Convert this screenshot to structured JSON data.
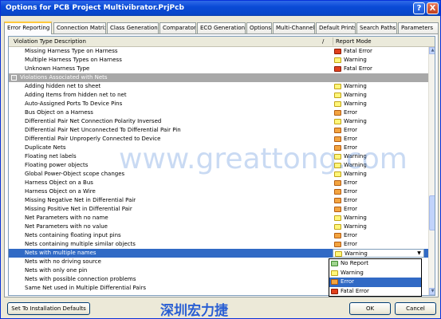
{
  "window": {
    "title": "Options for PCB Project Multivibrator.PrjPcb",
    "help_glyph": "?",
    "close_glyph": "X"
  },
  "tabs": [
    "Error Reporting",
    "Connection Matrix",
    "Class Generation",
    "Comparator",
    "ECO Generation",
    "Options",
    "Multi-Channel",
    "Default Prints",
    "Search Paths",
    "Parameters"
  ],
  "table": {
    "col_violation": "Violation Type Description",
    "col_report": "Report Mode",
    "header_glyph": "/",
    "group_glyph": "-",
    "dropdown_glyph": "▼",
    "rows": [
      {
        "name": "Missing Harness Type on Harness",
        "mode": "Fatal Error",
        "icon": "fatal"
      },
      {
        "name": "Multiple Harness Types on Harness",
        "mode": "Warning",
        "icon": "warning"
      },
      {
        "name": "Unknown Harness Type",
        "mode": "Fatal Error",
        "icon": "fatal"
      },
      {
        "name": "Violations Associated with Nets",
        "group": true
      },
      {
        "name": "Adding hidden net to sheet",
        "mode": "Warning",
        "icon": "warning"
      },
      {
        "name": "Adding Items from hidden net to net",
        "mode": "Warning",
        "icon": "warning"
      },
      {
        "name": "Auto-Assigned Ports To Device Pins",
        "mode": "Warning",
        "icon": "warning"
      },
      {
        "name": "Bus Object on a Harness",
        "mode": "Error",
        "icon": "error"
      },
      {
        "name": "Differential Pair Net Connection Polarity Inversed",
        "mode": "Warning",
        "icon": "warning"
      },
      {
        "name": "Differential Pair Net Unconnected To Differential Pair Pin",
        "mode": "Error",
        "icon": "error"
      },
      {
        "name": "Differential Pair Unproperly Connected to Device",
        "mode": "Error",
        "icon": "error"
      },
      {
        "name": "Duplicate Nets",
        "mode": "Error",
        "icon": "error"
      },
      {
        "name": "Floating net labels",
        "mode": "Warning",
        "icon": "warning"
      },
      {
        "name": "Floating power objects",
        "mode": "Warning",
        "icon": "warning"
      },
      {
        "name": "Global Power-Object scope changes",
        "mode": "Warning",
        "icon": "warning"
      },
      {
        "name": "Harness Object on a Bus",
        "mode": "Error",
        "icon": "error"
      },
      {
        "name": "Harness Object on a Wire",
        "mode": "Error",
        "icon": "error"
      },
      {
        "name": "Missing Negative Net in Differential Pair",
        "mode": "Error",
        "icon": "error"
      },
      {
        "name": "Missing Positive Net in Differential Pair",
        "mode": "Error",
        "icon": "error"
      },
      {
        "name": "Net Parameters with no name",
        "mode": "Warning",
        "icon": "warning"
      },
      {
        "name": "Net Parameters with no value",
        "mode": "Warning",
        "icon": "warning"
      },
      {
        "name": "Nets containing floating input pins",
        "mode": "Error",
        "icon": "error"
      },
      {
        "name": "Nets containing multiple similar objects",
        "mode": "Error",
        "icon": "error"
      },
      {
        "name": "Nets with multiple names",
        "mode": "Warning",
        "icon": "warning",
        "selected": true
      },
      {
        "name": "Nets with no driving source",
        "mode": "",
        "icon": ""
      },
      {
        "name": "Nets with only one pin",
        "mode": "",
        "icon": ""
      },
      {
        "name": "Nets with possible connection problems",
        "mode": "",
        "icon": ""
      },
      {
        "name": "Same Net used in Multiple Differential Pairs",
        "mode": "",
        "icon": ""
      }
    ]
  },
  "dropdown_options": [
    {
      "label": "No Report",
      "icon": "noreport"
    },
    {
      "label": "Warning",
      "icon": "warning"
    },
    {
      "label": "Error",
      "icon": "error",
      "highlighted": true
    },
    {
      "label": "Fatal Error",
      "icon": "fatal"
    }
  ],
  "scroll_glyphs": {
    "up": "▲",
    "down": "▼"
  },
  "buttons": {
    "reset": "Set To Installation Defaults",
    "ok": "OK",
    "cancel": "Cancel"
  },
  "watermark": {
    "url": "www.greattong.com",
    "cn": "深圳宏力捷"
  }
}
